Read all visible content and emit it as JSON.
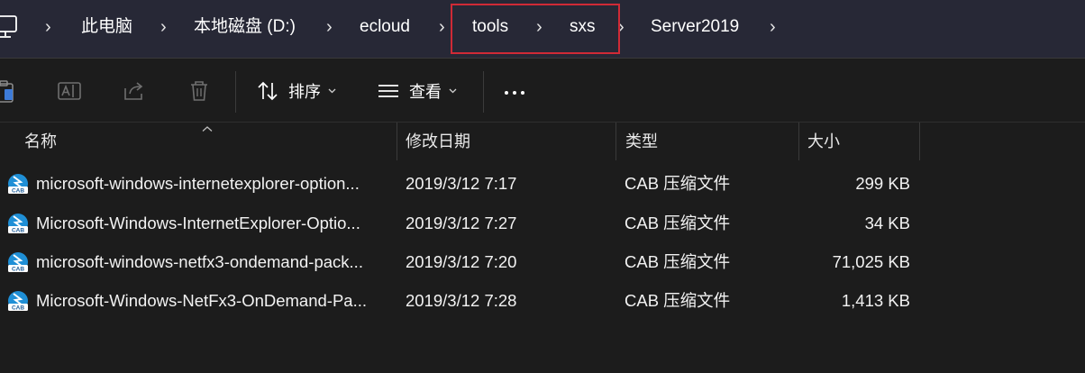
{
  "address": {
    "crumbs": [
      "此电脑",
      "本地磁盘 (D:)",
      "ecloud",
      "tools",
      "sxs",
      "Server2019"
    ],
    "separator": "›"
  },
  "toolbar": {
    "sort_label": "排序",
    "view_label": "查看",
    "icons": [
      "paste-icon",
      "rename-icon",
      "share-icon",
      "delete-icon",
      "sort-icon",
      "view-icon",
      "more-icon"
    ]
  },
  "columns": {
    "name": "名称",
    "date": "修改日期",
    "type": "类型",
    "size": "大小"
  },
  "files": [
    {
      "name": "microsoft-windows-internetexplorer-option...",
      "date": "2019/3/12 7:17",
      "type": "CAB 压缩文件",
      "size": "299 KB"
    },
    {
      "name": "Microsoft-Windows-InternetExplorer-Optio...",
      "date": "2019/3/12 7:27",
      "type": "CAB 压缩文件",
      "size": "34 KB"
    },
    {
      "name": "microsoft-windows-netfx3-ondemand-pack...",
      "date": "2019/3/12 7:20",
      "type": "CAB 压缩文件",
      "size": "71,025 KB"
    },
    {
      "name": "Microsoft-Windows-NetFx3-OnDemand-Pa...",
      "date": "2019/3/12 7:28",
      "type": "CAB 压缩文件",
      "size": "1,413 KB"
    }
  ],
  "icon_label": "CAB",
  "colors": {
    "address_bg": "#272836",
    "window_bg": "#1c1c1c",
    "highlight": "#d02a36",
    "cab_icon": "#1f8fd6"
  }
}
